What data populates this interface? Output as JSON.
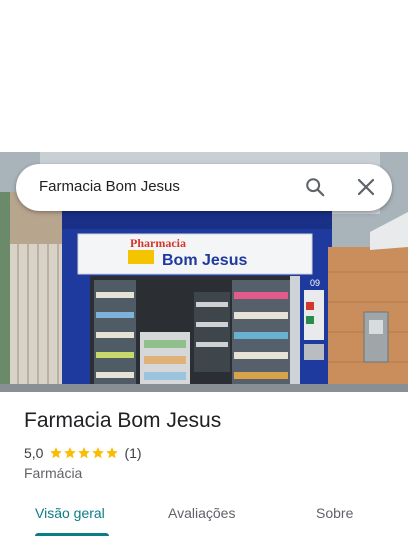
{
  "search": {
    "query": "Farmacia Bom Jesus"
  },
  "place": {
    "name": "Farmacia Bom Jesus",
    "rating": "5,0",
    "stars": 5,
    "review_count": "(1)",
    "category": "Farmácia"
  },
  "photo": {
    "sign_line1": "Pharmacia",
    "sign_line2": "Bom Jesus",
    "house_number": "09"
  },
  "tabs": [
    {
      "label": "Visão geral",
      "active": true
    },
    {
      "label": "Avaliações",
      "active": false
    },
    {
      "label": "Sobre",
      "active": false
    }
  ],
  "colors": {
    "accent": "#0b7d86",
    "star": "#fbbc04",
    "facade_blue": "#1f3a9e"
  }
}
